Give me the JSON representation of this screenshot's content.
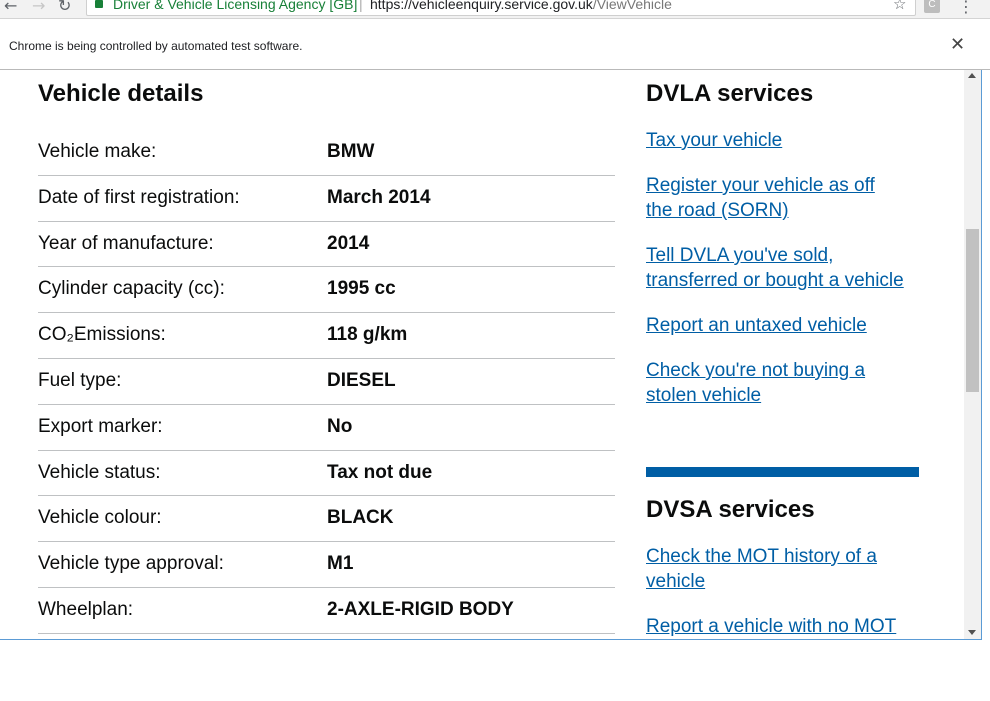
{
  "browser": {
    "site_name": "Driver & Vehicle Licensing Agency [GB]",
    "url_host": "https://vehicleenquiry.service.gov.uk",
    "url_path": "/ViewVehicle",
    "extension_label": "C"
  },
  "infobar": {
    "message": "Chrome is being controlled by automated test software."
  },
  "vehicle": {
    "heading": "Vehicle details",
    "rows": [
      {
        "label": "Vehicle make:",
        "value": "BMW"
      },
      {
        "label": "Date of first registration:",
        "value": "March 2014"
      },
      {
        "label": "Year of manufacture:",
        "value": "2014"
      },
      {
        "label": "Cylinder capacity (cc):",
        "value": "1995 cc"
      },
      {
        "label": "CO₂Emissions:",
        "value": "118 g/km"
      },
      {
        "label": "Fuel type:",
        "value": "DIESEL"
      },
      {
        "label": "Export marker:",
        "value": "No"
      },
      {
        "label": "Vehicle status:",
        "value": "Tax not due"
      },
      {
        "label": "Vehicle colour:",
        "value": "BLACK"
      },
      {
        "label": "Vehicle type approval:",
        "value": "M1"
      },
      {
        "label": "Wheelplan:",
        "value": "2-AXLE-RIGID BODY"
      }
    ]
  },
  "dvla": {
    "heading": "DVLA services",
    "links": [
      "Tax your vehicle",
      "Register your vehicle as off the road (SORN)",
      "Tell DVLA you've sold, transferred or bought a vehicle",
      "Report an untaxed vehicle",
      "Check you're not buying a stolen vehicle"
    ]
  },
  "dvsa": {
    "heading": "DVSA services",
    "links": [
      "Check the MOT history of a vehicle",
      "Report a vehicle with no MOT"
    ]
  },
  "colors": {
    "link": "#005ea5",
    "accent_bar": "#005ea5",
    "text": "#0b0c0c",
    "secure_green": "#188038"
  },
  "icons": [
    "back-icon",
    "forward-icon",
    "reload-icon",
    "lock-icon",
    "star-icon",
    "menu-icon",
    "close-icon"
  ]
}
